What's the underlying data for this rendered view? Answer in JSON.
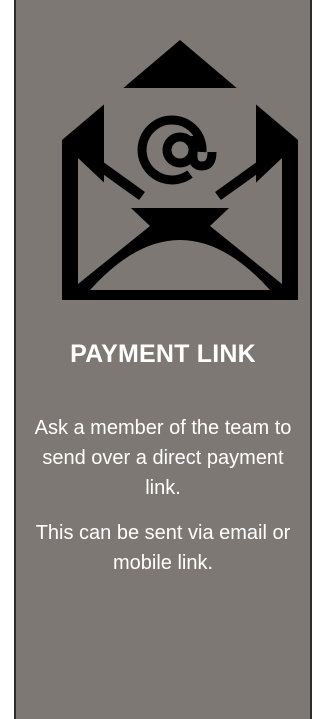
{
  "card": {
    "icon": "envelope-email-icon",
    "title": "PAYMENT LINK",
    "description_1": "Ask a member of the team to send over a direct payment link.",
    "description_2": "This can be sent via email or mobile link."
  },
  "colors": {
    "card_background": "#7d7874",
    "text": "#ffffff",
    "icon": "#000000"
  }
}
